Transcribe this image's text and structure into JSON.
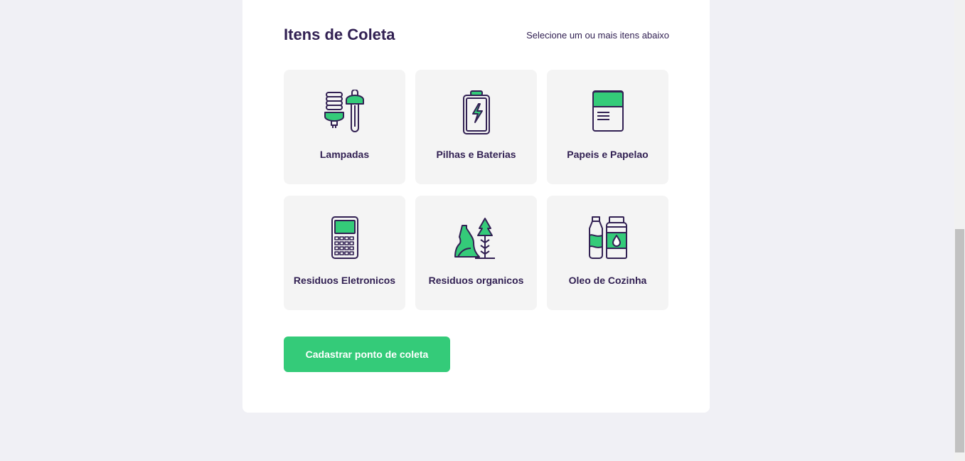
{
  "fieldset": {
    "title": "Itens de Coleta",
    "hint": "Selecione um ou mais itens abaixo"
  },
  "items": [
    {
      "label": "Lampadas",
      "icon": "lamp-icon"
    },
    {
      "label": "Pilhas e Baterias",
      "icon": "battery-icon"
    },
    {
      "label": "Papeis e Papelao",
      "icon": "paper-icon"
    },
    {
      "label": "Residuos Eletronicos",
      "icon": "electronics-icon"
    },
    {
      "label": "Residuos organicos",
      "icon": "organic-icon"
    },
    {
      "label": "Oleo de Cozinha",
      "icon": "oil-icon"
    }
  ],
  "submit_label": "Cadastrar ponto de coleta",
  "colors": {
    "primary": "#34cb79",
    "title": "#322153",
    "item_bg": "#f4f4f4",
    "page_bg": "#f0f0f5"
  }
}
